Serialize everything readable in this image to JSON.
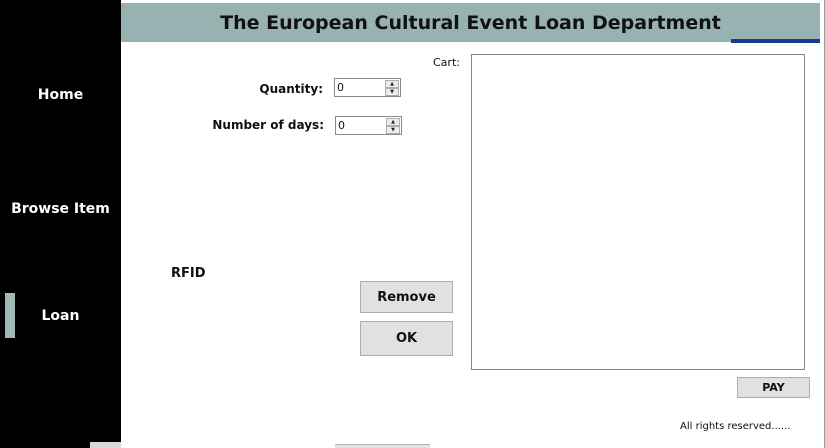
{
  "header": {
    "title": "The European Cultural Event Loan Department"
  },
  "sidebar": {
    "items": [
      {
        "label": "Home"
      },
      {
        "label": "Browse Item"
      },
      {
        "label": "Loan"
      }
    ],
    "active": "Loan"
  },
  "form": {
    "quantity_label": "Quantity:",
    "quantity_value": "0",
    "days_label": "Number of days:",
    "days_value": "0",
    "rfid_label": "RFID"
  },
  "buttons": {
    "remove": "Remove",
    "ok": "OK",
    "pay": "PAY"
  },
  "cart": {
    "label": "Cart:"
  },
  "footer": {
    "text": "All rights reserved......"
  },
  "colors": {
    "sidebar_bg": "#000000",
    "header_bg": "#97b2b0",
    "active_indicator": "#9fb9b7",
    "accent": "#1a3c8c"
  }
}
